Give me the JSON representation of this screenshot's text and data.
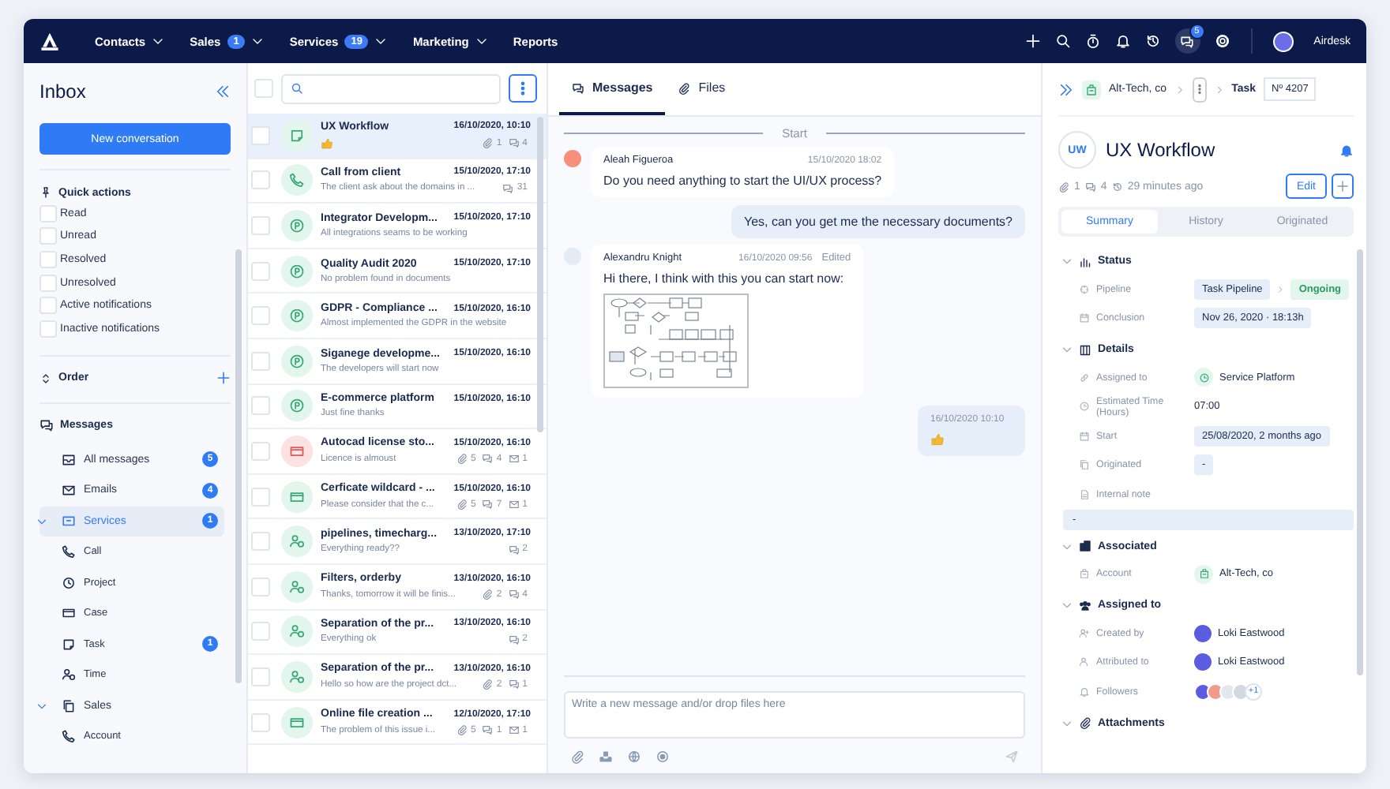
{
  "nav": {
    "items": [
      {
        "label": "Contacts",
        "dropdown": true
      },
      {
        "label": "Sales",
        "badge": "1",
        "dropdown": true
      },
      {
        "label": "Services",
        "badge": "19",
        "dropdown": true
      },
      {
        "label": "Marketing",
        "dropdown": true
      },
      {
        "label": "Reports",
        "dropdown": false
      }
    ],
    "notification_badge": "5",
    "user": "Airdesk"
  },
  "sidebar": {
    "title": "Inbox",
    "new_button": "New conversation",
    "quick_actions": {
      "title": "Quick actions",
      "items": [
        {
          "label": "Read",
          "checked": false
        },
        {
          "label": "Unread",
          "checked": false
        },
        {
          "label": "Resolved",
          "checked": false
        },
        {
          "label": "Unresolved",
          "checked": false
        },
        {
          "label": "Active notifications",
          "checked": false
        },
        {
          "label": "Inactive notifications",
          "checked": false
        }
      ]
    },
    "order": {
      "title": "Order"
    },
    "messages": {
      "title": "Messages",
      "items": [
        {
          "label": "All messages",
          "badge": "5",
          "selected": false
        },
        {
          "label": "Emails",
          "badge": "4",
          "selected": false
        },
        {
          "label": "Services",
          "badge": "1",
          "selected": true,
          "expanded": true,
          "children": [
            {
              "label": "Call",
              "selected": false
            },
            {
              "label": "Project",
              "selected": false
            },
            {
              "label": "Case",
              "selected": false
            },
            {
              "label": "Task",
              "badge": "1",
              "selected": false
            },
            {
              "label": "Time",
              "selected": false
            }
          ]
        },
        {
          "label": "Sales",
          "selected": false,
          "expanded": true,
          "children": [
            {
              "label": "Account",
              "selected": false
            }
          ]
        }
      ]
    }
  },
  "conversations": {
    "select_all_checked": false,
    "items": [
      {
        "title": "UX Workflow",
        "date": "16/10/2020, 10:10",
        "reaction": true,
        "kind": "task",
        "color": "#e3f6ee",
        "selected": true,
        "checked": false,
        "attachments": "1",
        "comments": "4"
      },
      {
        "title": "Call from client",
        "date": "15/10/2020, 17:10",
        "preview": "The client ask about the domains in ...",
        "reaction": false,
        "kind": "call",
        "color": "#e3f6ee",
        "selected": false,
        "checked": false,
        "comments": "31"
      },
      {
        "title": "Integrator Developm...",
        "date": "15/10/2020, 17:10",
        "preview": "All integrations seams to be working",
        "reaction": false,
        "kind": "project",
        "color": "#e3f6ee",
        "selected": false,
        "checked": false
      },
      {
        "title": "Quality Audit 2020",
        "date": "15/10/2020, 17:10",
        "preview": "No problem found in documents",
        "reaction": false,
        "kind": "project",
        "color": "#e3f6ee",
        "selected": false,
        "checked": false
      },
      {
        "title": "GDPR - Compliance ...",
        "date": "15/10/2020, 16:10",
        "preview": "Almost implemented the GDPR in the website",
        "reaction": false,
        "kind": "project",
        "color": "#e3f6ee",
        "selected": false,
        "checked": false
      },
      {
        "title": "Siganege developme...",
        "date": "15/10/2020, 16:10",
        "preview": "The developers will start now",
        "reaction": false,
        "kind": "project",
        "color": "#e3f6ee",
        "selected": false,
        "checked": false
      },
      {
        "title": "E-commerce platform",
        "date": "15/10/2020, 16:10",
        "preview": "Just fine thanks",
        "reaction": false,
        "kind": "project",
        "color": "#e3f6ee",
        "selected": false,
        "checked": false
      },
      {
        "title": "Autocad license sto...",
        "date": "15/10/2020, 16:10",
        "preview": "Licence is almoust",
        "reaction": false,
        "kind": "ticket",
        "color": "#fde2e2",
        "selected": false,
        "checked": false,
        "attachments": "5",
        "comments": "4",
        "emails": "1"
      },
      {
        "title": "Cerficate wildcard - ...",
        "date": "15/10/2020, 16:10",
        "preview": "Please consider that the c...",
        "reaction": false,
        "kind": "ticket",
        "color": "#e3f6ee",
        "selected": false,
        "checked": false,
        "attachments": "5",
        "comments": "7",
        "emails": "1"
      },
      {
        "title": "pipelines, timecharg...",
        "date": "13/10/2020, 17:10",
        "preview": "Everything ready??",
        "reaction": false,
        "kind": "time",
        "color": "#e3f6ee",
        "selected": false,
        "checked": false,
        "comments": "2"
      },
      {
        "title": "Filters, orderby",
        "date": "13/10/2020, 16:10",
        "preview": "Thanks, tomorrow it will be finis...",
        "reaction": false,
        "kind": "time",
        "color": "#e3f6ee",
        "selected": false,
        "checked": false,
        "attachments": "2",
        "comments": "4"
      },
      {
        "title": "Separation of the pr...",
        "date": "13/10/2020, 16:10",
        "preview": "Everything ok",
        "reaction": false,
        "kind": "time",
        "color": "#e3f6ee",
        "selected": false,
        "checked": false,
        "comments": "2"
      },
      {
        "title": "Separation of the pr...",
        "date": "13/10/2020, 16:10",
        "preview": "Hello so how are the project dct...",
        "reaction": false,
        "kind": "time",
        "color": "#e3f6ee",
        "selected": false,
        "checked": false,
        "attachments": "2",
        "comments": "1"
      },
      {
        "title": "Online file creation ...",
        "date": "12/10/2020, 17:10",
        "preview": "The problem of this issue i...",
        "reaction": false,
        "kind": "ticket",
        "color": "#e3f6ee",
        "selected": false,
        "checked": false,
        "attachments": "5",
        "comments": "1",
        "emails": "1"
      }
    ]
  },
  "chat": {
    "tabs": [
      {
        "label": "Messages",
        "selected": true
      },
      {
        "label": "Files",
        "selected": false
      }
    ],
    "divider": "Start",
    "messages": [
      {
        "kind": "incoming",
        "author": "Aleah Figueroa",
        "time": "15/10/2020 18:02",
        "text": "Do you need anything to start the UI/UX process?",
        "color": "#f7907a"
      },
      {
        "kind": "outgoing",
        "text": "Yes, can you get me the necessary documents?"
      },
      {
        "kind": "incoming",
        "author": "Alexandru Knight",
        "time": "16/10/2020 09:56",
        "edited": "Edited",
        "text": "Hi there, I think with this you can start now:",
        "color": "#e3ebf5",
        "attachment": true
      },
      {
        "kind": "outgoing",
        "time": "16/10/2020 10:10",
        "reaction": true
      }
    ],
    "composer": {
      "placeholder": "Write a new message and/or drop files here"
    }
  },
  "detail": {
    "breadcrumb": {
      "account": "Alt-Tech, co",
      "type": "Task",
      "number": "Nº 4207"
    },
    "avatar": "UW",
    "title": "UX Workflow",
    "meta": {
      "attachments": "1",
      "comments": "4",
      "updated": "29 minutes ago"
    },
    "edit_button": "Edit",
    "tabs": [
      {
        "label": "Summary",
        "selected": true
      },
      {
        "label": "History",
        "selected": false
      },
      {
        "label": "Originated",
        "selected": false
      }
    ],
    "sections": [
      {
        "title": "Status",
        "expanded": true,
        "fields": [
          {
            "label": "Pipeline",
            "kind": "pipeline",
            "value": "Task Pipeline",
            "stage": "Ongoing"
          },
          {
            "label": "Conclusion",
            "kind": "chip",
            "value": "Nov 26, 2020 · 18:13h"
          }
        ]
      },
      {
        "title": "Details",
        "expanded": true,
        "fields": [
          {
            "label": "Assigned to",
            "kind": "service",
            "value": "Service Platform"
          },
          {
            "label": "Estimated Time (Hours)",
            "kind": "text",
            "value": "07:00"
          },
          {
            "label": "Start",
            "kind": "chip",
            "value": "25/08/2020, 2 months ago"
          },
          {
            "label": "Originated",
            "kind": "chip",
            "value": "-"
          },
          {
            "label": "Internal note",
            "kind": "note",
            "value": "-"
          }
        ]
      },
      {
        "title": "Associated",
        "expanded": true,
        "fields": [
          {
            "label": "Account",
            "kind": "account",
            "value": "Alt-Tech, co"
          }
        ]
      },
      {
        "title": "Assigned to",
        "expanded": true,
        "fields": [
          {
            "label": "Created by",
            "kind": "person",
            "value": "Loki Eastwood",
            "color": "#5b5ce0"
          },
          {
            "label": "Attributed to",
            "kind": "person",
            "value": "Loki Eastwood",
            "color": "#5b5ce0"
          },
          {
            "label": "Followers",
            "kind": "followers",
            "avatars": [
              {
                "color": "#5b5ce0"
              },
              {
                "color": "#f29b8a"
              },
              {
                "color": "#e3e8ef"
              },
              {
                "color": "#d3d9e1"
              }
            ],
            "more": "+1"
          }
        ]
      },
      {
        "title": "Attachments",
        "expanded": true
      }
    ]
  }
}
